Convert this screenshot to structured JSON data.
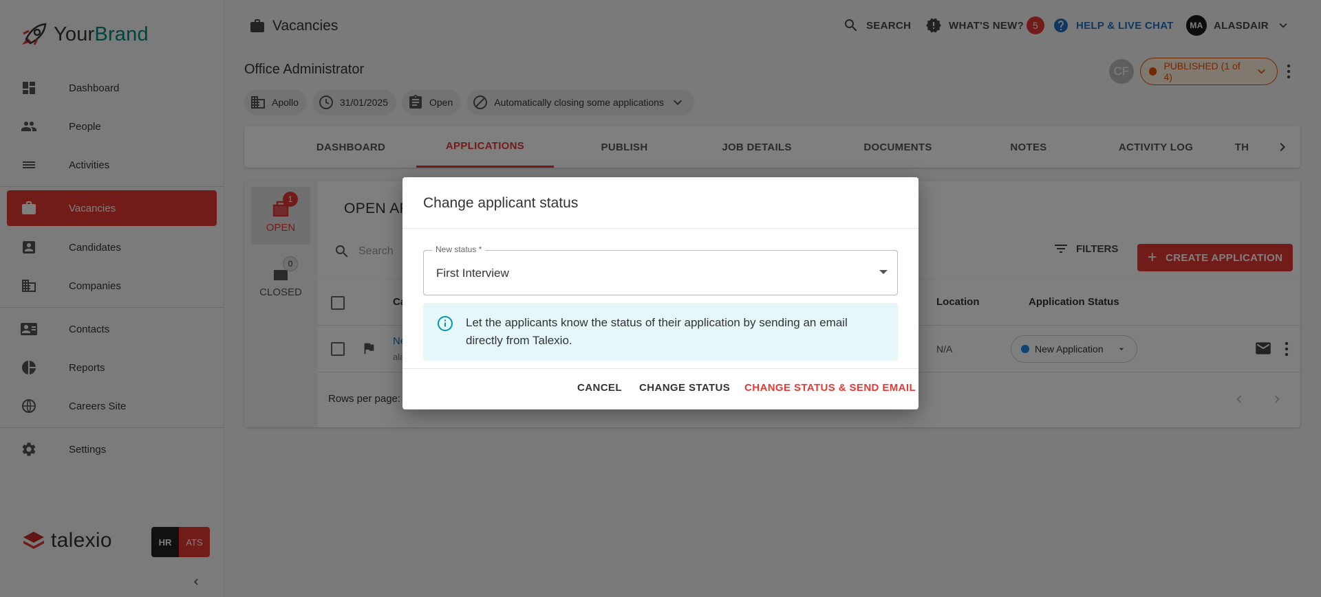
{
  "brand": {
    "part1": "Your",
    "part2": "Brand"
  },
  "sidebar": {
    "items": [
      {
        "label": "Dashboard",
        "icon": "dashboard-icon"
      },
      {
        "label": "People",
        "icon": "people-icon"
      },
      {
        "label": "Activities",
        "icon": "activities-icon"
      },
      {
        "label": "Vacancies",
        "icon": "briefcase-icon",
        "active": true
      },
      {
        "label": "Candidates",
        "icon": "candidates-icon"
      },
      {
        "label": "Companies",
        "icon": "companies-icon"
      },
      {
        "label": "Contacts",
        "icon": "contacts-icon"
      },
      {
        "label": "Reports",
        "icon": "pie-chart-icon"
      },
      {
        "label": "Careers Site",
        "icon": "globe-icon"
      },
      {
        "label": "Settings",
        "icon": "gear-icon"
      }
    ],
    "talexio": "talexio",
    "hr": "HR",
    "ats": "ATS"
  },
  "header": {
    "title": "Vacancies",
    "search": "SEARCH",
    "whats_new": "WHAT'S NEW?",
    "whats_new_count": "5",
    "help": "HELP & LIVE CHAT",
    "avatar_initials": "MA",
    "user": "ALASDAIR"
  },
  "job": {
    "title": "Office Administrator",
    "company": "Apollo",
    "date": "31/01/2025",
    "status": "Open",
    "auto_close": "Automatically closing some applications",
    "cf_initials": "CF",
    "published": "PUBLISHED (1 of 4)"
  },
  "tabs": [
    "DASHBOARD",
    "APPLICATIONS",
    "PUBLISH",
    "JOB DETAILS",
    "DOCUMENTS",
    "NOTES",
    "ACTIVITY LOG",
    "TH"
  ],
  "apps": {
    "open_label": "OPEN",
    "open_count": "1",
    "closed_label": "CLOSED",
    "closed_count": "0",
    "section_title": "OPEN AP",
    "search_placeholder": "Search",
    "filters": "FILTERS",
    "create": "CREATE APPLICATION",
    "col_candidate": "Ca",
    "col_location": "Location",
    "col_status": "Application Status",
    "row_name": "Ne",
    "row_email": "ala",
    "row_location": "N/A",
    "row_status": "New Application",
    "rows_per_page": "Rows per page:"
  },
  "dialog": {
    "title": "Change applicant status",
    "field_label": "New status *",
    "field_value": "First Interview",
    "info": "Let the applicants know the status of their application by sending an email directly from Talexio.",
    "cancel": "CANCEL",
    "change_status": "CHANGE STATUS",
    "change_send": "CHANGE STATUS & SEND EMAIL"
  },
  "colors": {
    "accent": "#e53935",
    "brand_teal": "#00897b",
    "published": "#e65100",
    "info_bg": "#e5f7f9"
  }
}
